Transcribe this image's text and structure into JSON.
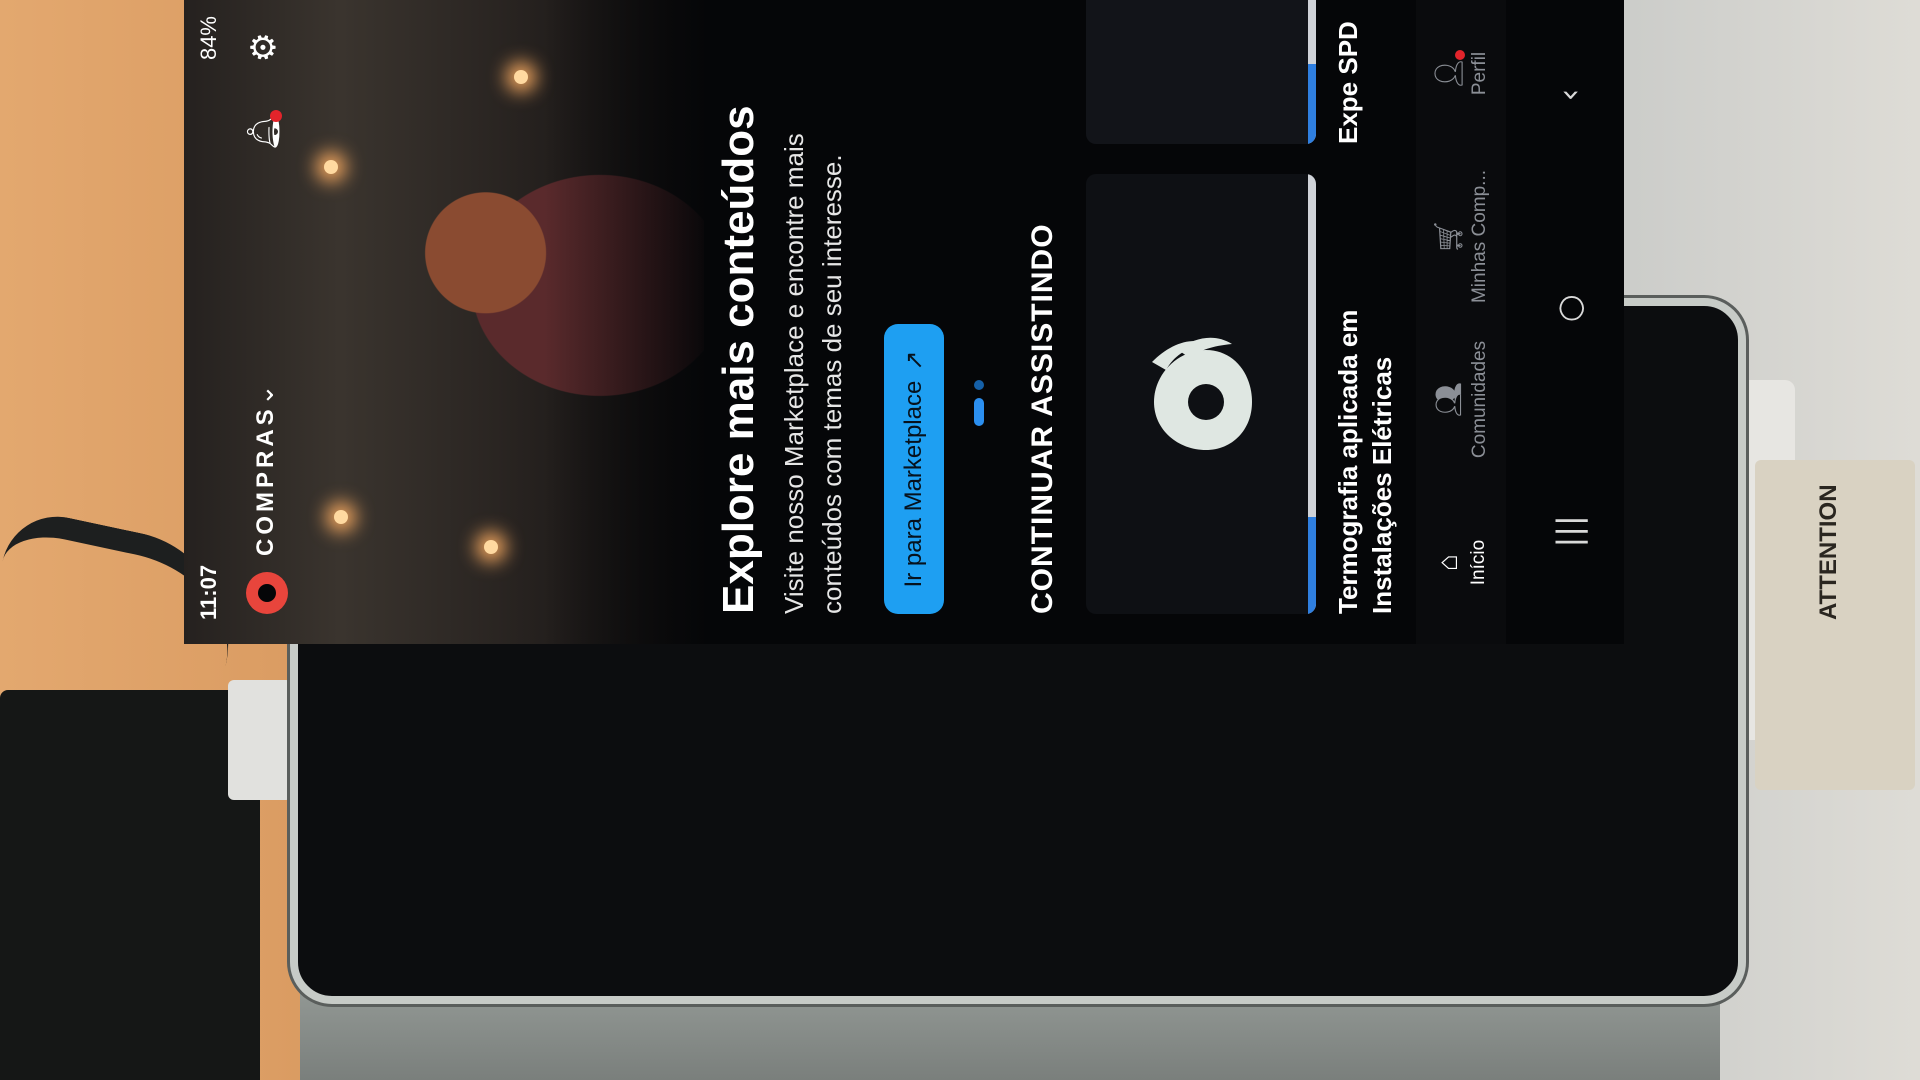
{
  "status_bar": {
    "time": "11:07",
    "battery": "84%"
  },
  "header": {
    "brand_label": "COMPRAS",
    "chevron_icon": "chevron-down-icon",
    "notification_icon": "bell-icon",
    "settings_icon": "settings-icon"
  },
  "banner": {
    "title": "Explore mais conteúdos",
    "description": "Visite nosso Marketplace e encontre mais conteúdos com temas de seu interesse.",
    "button_label": "Ir para Marketplace",
    "button_icon": "external-link-icon",
    "pager_count": 2,
    "pager_active": 1
  },
  "continue_watching": {
    "section_title": "CONTINUAR ASSISTINDO",
    "items": [
      {
        "title": "Termografia aplicada em Instalações Elétricas",
        "progress": 0.22
      },
      {
        "title": "Expe SPD",
        "progress": 0.4
      }
    ]
  },
  "bottom_nav": {
    "items": [
      {
        "label": "Início",
        "icon": "home-icon",
        "active": true
      },
      {
        "label": "Comunidades",
        "icon": "community-icon",
        "active": false
      },
      {
        "label": "Minhas Comp...",
        "icon": "cart-icon",
        "active": false
      },
      {
        "label": "Perfil",
        "icon": "profile-icon",
        "active": false,
        "badge": true
      }
    ]
  },
  "system_nav": {
    "recents_icon": "recents-icon",
    "home_icon": "home-circle-icon",
    "back_icon": "back-icon"
  },
  "background": {
    "label_text": "ATTENTION"
  },
  "colors": {
    "accent": "#1e9ff2",
    "brand": "#e8453c",
    "badge": "#e3242b",
    "screen_bg": "#050608"
  }
}
